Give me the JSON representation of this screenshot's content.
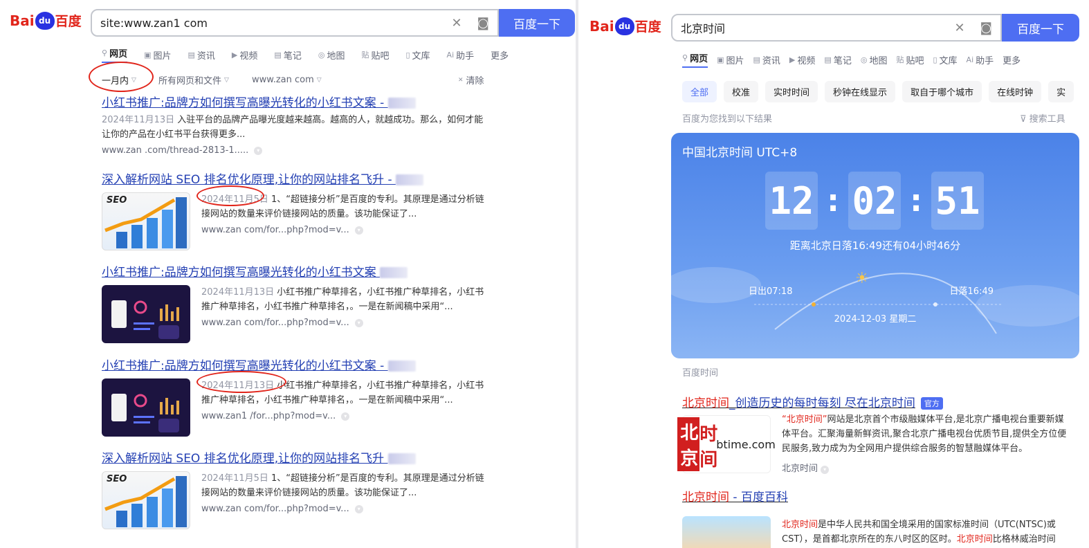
{
  "left": {
    "logo": {
      "bai": "Bai",
      "du": "du",
      "cn": "百度"
    },
    "search": {
      "query": "site:www.zan1  com",
      "clear_icon": "close-icon",
      "camera_icon": "camera-icon",
      "button": "百度一下"
    },
    "tabs": [
      {
        "label": "网页",
        "icon": "search-icon"
      },
      {
        "label": "图片",
        "icon": "image-icon"
      },
      {
        "label": "资讯",
        "icon": "news-icon"
      },
      {
        "label": "视频",
        "icon": "video-icon"
      },
      {
        "label": "笔记",
        "icon": "note-icon"
      },
      {
        "label": "地图",
        "icon": "map-icon"
      },
      {
        "label": "贴吧",
        "icon": "tieba-icon"
      },
      {
        "label": "文库",
        "icon": "doc-icon"
      },
      {
        "label": "助手",
        "icon": "ai-icon"
      },
      {
        "label": "更多",
        "icon": ""
      }
    ],
    "filters": {
      "time": "一月内",
      "type": "所有网页和文件",
      "site": "www.zan    com",
      "clear": "清除"
    },
    "results": [
      {
        "title": "小红书推广:品牌方如何撰写高曝光转化的小红书文案 - ",
        "date": "2024年11月13日",
        "abstract": " 入驻平台的品牌产品曝光度越来越高。越高的人，就越成功。那么，如何才能让你的产品在小红书平台获得更多...",
        "url": "www.zan    .com/thread-2813-1....."
      },
      {
        "title": "深入解析网站 SEO 排名优化原理,让你的网站排名飞升 - ",
        "date": "2024年11月5日",
        "abstract": " 1、“超链接分析”是百度的专利。其原理是通过分析链接网站的数量来评价链接网站的质量。该功能保证了...",
        "url": "www.zan    com/for...php?mod=v..."
      },
      {
        "title": "小红书推广:品牌方如何撰写高曝光转化的小红书文案 ",
        "date": "2024年11月13日",
        "abstract": " 小红书推广种草排名，小红书推广种草排名，小红书推广种草排名，小红书推广种草排名，。一是在新闻稿中采用“...",
        "url": "www.zan    com/for...php?mod=v..."
      },
      {
        "title": "小红书推广:品牌方如何撰写高曝光转化的小红书文案 - ",
        "date": "2024年11月13日",
        "abstract": " 小红书推广种草排名，小红书推广种草排名，小红书推广种草排名，小红书推广种草排名，。一是在新闻稿中采用“...",
        "url": "www.zan1   /for...php?mod=v..."
      },
      {
        "title": "深入解析网站 SEO 排名优化原理,让你的网站排名飞升 ",
        "date": "2024年11月5日",
        "abstract": " 1、“超链接分析”是百度的专利。其原理是通过分析链接网站的数量来评价链接网站的质量。该功能保证了...",
        "url": "www.zan    com/for...php?mod=v..."
      }
    ]
  },
  "right": {
    "logo": {
      "bai": "Bai",
      "du": "du",
      "cn": "百度"
    },
    "search": {
      "query": "北京时间",
      "button": "百度一下"
    },
    "tabs": [
      {
        "label": "网页"
      },
      {
        "label": "图片"
      },
      {
        "label": "资讯"
      },
      {
        "label": "视频"
      },
      {
        "label": "笔记"
      },
      {
        "label": "地图"
      },
      {
        "label": "贴吧"
      },
      {
        "label": "文库"
      },
      {
        "label": "助手"
      },
      {
        "label": "更多"
      }
    ],
    "pills": [
      "全部",
      "校准",
      "实时时间",
      "秒钟在线显示",
      "取自于哪个城市",
      "在线时钟",
      "实"
    ],
    "found": "百度为您找到以下结果",
    "tools": "搜索工具",
    "clock": {
      "title": "中国北京时间 UTC+8",
      "hh": "12",
      "mm": "02",
      "ss": "51",
      "sunset_note": "距离北京日落16:49还有04小时46分",
      "sunrise": "日出07:18",
      "sunset": "日落16:49",
      "date": "2024-12-03   星期二"
    },
    "source": "百度时间",
    "result1": {
      "title_hl": "北京时间",
      "title_rest": "_创造历史的每时每刻 尽在北京时间",
      "badge": "官方",
      "abs_hl": "“北京时间”",
      "abstract": "网站是北京首个市级融媒体平台,是北京广播电视台重要新媒体平台。汇聚海量新鲜资讯,聚合北京广播电视台优质节目,提供全方位便民服务,致力成为为全网用户提供综合服务的智慧融媒体平台。",
      "site": "北京时间",
      "logo_red": "北京",
      "logo_text": "时间",
      "logo_sub": "btime.com"
    },
    "result2": {
      "title_hl": "北京时间",
      "title_rest": " - 百度百科",
      "abs_hl": "北京时间",
      "abstract": "是中华人民共和国全境采用的国家标准时间（UTC(NTSC)或CST），是首都北京所在的东八时区的区时。",
      "abs_hl2": "北京时间",
      "abstract2": "比格林威治时间(Gre"
    }
  }
}
